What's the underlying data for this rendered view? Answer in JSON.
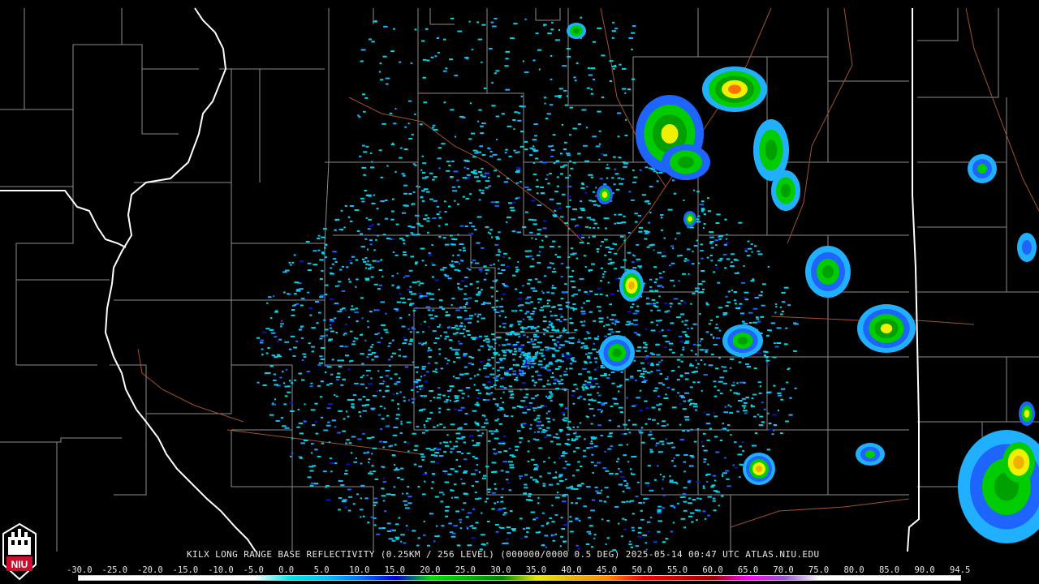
{
  "product": {
    "caption": "KILX LONG RANGE BASE REFLECTIVITY (0.25KM / 256 LEVEL) (000000/0000 0.5 DEG) 2025-05-14 00:47 UTC  ATLAS.NIU.EDU",
    "logo_text": "NIU"
  },
  "scale": {
    "labels": [
      "-30.0",
      "-25.0",
      "-20.0",
      "-15.0",
      "-10.0",
      "-5.0",
      "0.0",
      "5.0",
      "10.0",
      "15.0",
      "20.0",
      "25.0",
      "30.0",
      "35.0",
      "40.0",
      "45.0",
      "50.0",
      "55.0",
      "60.0",
      "65.0",
      "70.0",
      "75.0",
      "80.0",
      "85.0",
      "90.0",
      "94.5"
    ],
    "colors": [
      "#ffffff",
      "#ffffff",
      "#ffffff",
      "#ffffff",
      "#ffffff",
      "#ffffff",
      "#00e5e5",
      "#00bfff",
      "#0070ff",
      "#0000e0",
      "#00e000",
      "#00b800",
      "#008a00",
      "#e8e800",
      "#e8b400",
      "#ff8800",
      "#ff0000",
      "#d00000",
      "#a00000",
      "#ff00ff",
      "#9955cc",
      "#ffffff",
      "#ffffff",
      "#ffffff",
      "#ffffff",
      "#ffffff"
    ]
  },
  "map": {
    "background": "#000000",
    "county_line_color": "#8c8c8c",
    "state_line_color": "#ffffff",
    "road_color": "#a0522d"
  },
  "echo_palette": [
    "#00d8e8",
    "#20b0ff",
    "#1e64ff",
    "#1010d0",
    "#00cc00",
    "#00a000",
    "#f0f000",
    "#f0b000",
    "#ff7000"
  ]
}
